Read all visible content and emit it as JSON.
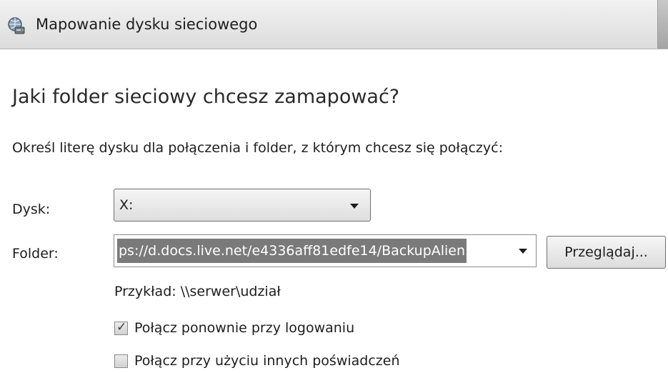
{
  "window": {
    "title": "Mapowanie dysku sieciowego",
    "icon": "network-drive-icon"
  },
  "main": {
    "heading": "Jaki folder sieciowy chcesz zamapować?",
    "instruction": "Określ literę dysku dla połączenia i folder, z którym chcesz się połączyć:"
  },
  "form": {
    "drive_label": "Dysk:",
    "drive_value": "X:",
    "folder_label": "Folder:",
    "folder_value": "ps://d.docs.live.net/e4336aff81edfe14/BackupAlien",
    "browse_label": "Przeglądaj...",
    "example": "Przykład: \\\\serwer\\udział",
    "reconnect_label": "Połącz ponownie przy logowaniu",
    "reconnect_checked": true,
    "credentials_label": "Połącz przy użyciu innych poświadczeń",
    "credentials_checked": false
  }
}
